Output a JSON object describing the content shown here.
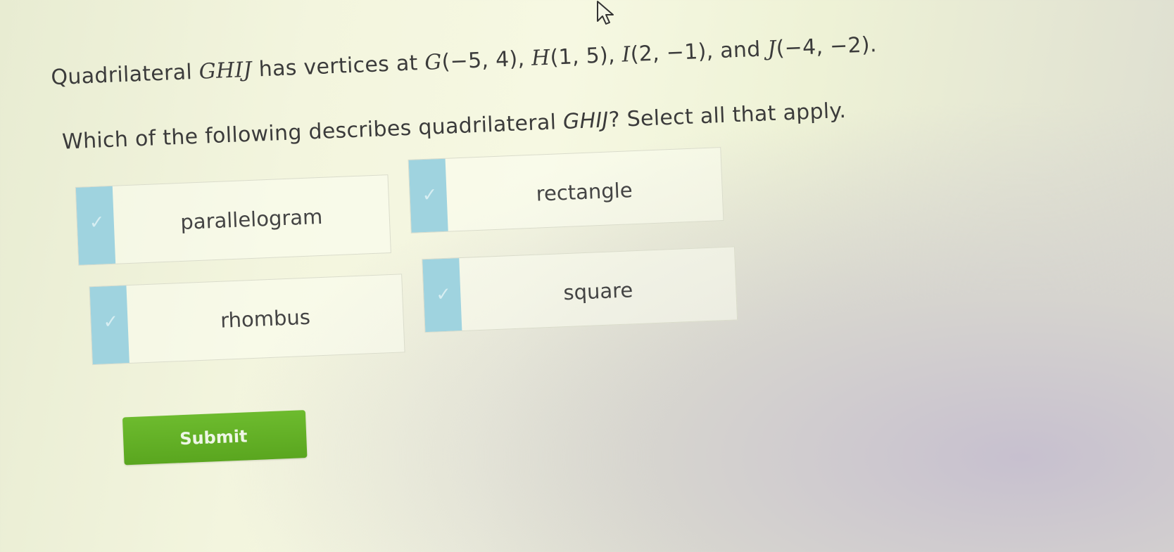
{
  "question": {
    "prefix": "Quadrilateral ",
    "shape_name": "GHIJ",
    "mid": " has vertices at ",
    "v1_name": "G",
    "v1_coords": "(−5, 4), ",
    "v2_name": "H",
    "v2_coords": "(1, 5), ",
    "v3_name": "I",
    "v3_coords": "(2, −1), and ",
    "v4_name": "J",
    "v4_coords": "(−4, −2)."
  },
  "instruction": {
    "prefix": "Which of the following describes quadrilateral ",
    "shape_name": "GHIJ",
    "suffix": "? Select all that apply."
  },
  "options": [
    {
      "label": "parallelogram",
      "checked": false
    },
    {
      "label": "rectangle",
      "checked": false
    },
    {
      "label": "rhombus",
      "checked": false
    },
    {
      "label": "square",
      "checked": false
    }
  ],
  "checkmark_glyph": "✓",
  "submit_label": "Submit",
  "colors": {
    "checkbox": "#9fd3df",
    "submit": "#5fae22",
    "text": "#3b3b3b"
  },
  "icons": {
    "cursor": "arrow-pointer-icon",
    "check": "checkmark-icon"
  }
}
